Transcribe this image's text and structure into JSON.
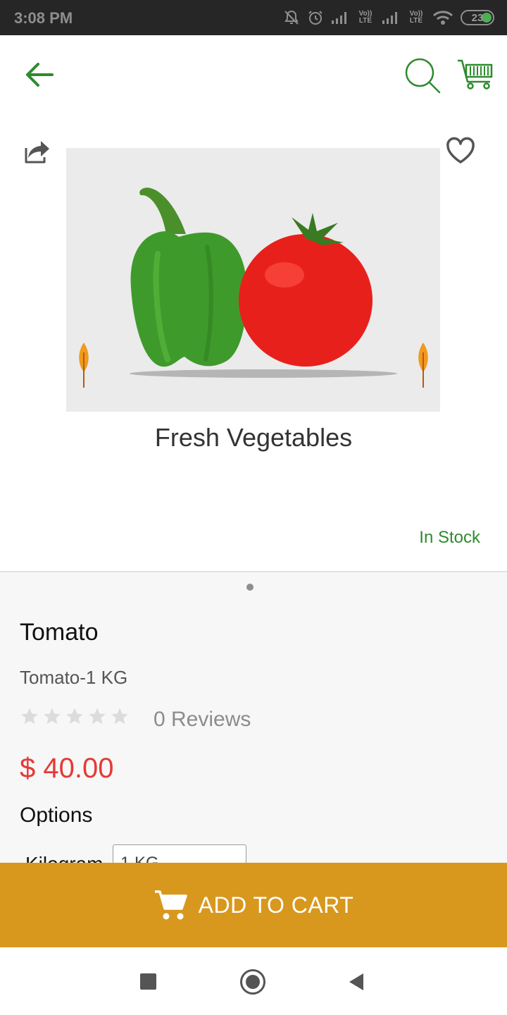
{
  "status_bar": {
    "time": "3:08 PM",
    "sim1_label": "Vo)) LTE",
    "sim2_label": "Vo)) LTE",
    "battery": "23",
    "icons": [
      "notifications-off-icon",
      "alarm-icon",
      "signal-icon",
      "signal-icon",
      "wifi-icon",
      "battery-icon"
    ]
  },
  "app_bar": {
    "icons": [
      "back-arrow-icon",
      "search-icon",
      "shopping-cart-icon"
    ],
    "accent_color": "#2e8b2e"
  },
  "product_image": {
    "caption": "Fresh Vegetables",
    "icons": [
      "share-icon",
      "heart-icon"
    ]
  },
  "stock_status": "In Stock",
  "product": {
    "name": "Tomato",
    "subtitle": "Tomato-1 KG",
    "rating": 0,
    "rating_max": 5,
    "reviews": "0 Reviews",
    "price": "$ 40.00",
    "price_color": "#e53935"
  },
  "options": {
    "heading": "Options",
    "label": "Kilogram",
    "selected_value": "1 KG"
  },
  "add_to_cart": {
    "label": "ADD TO CART",
    "background": "#d8981e"
  },
  "nav_bar": {
    "icons": [
      "recents-icon",
      "home-icon",
      "back-icon"
    ]
  }
}
